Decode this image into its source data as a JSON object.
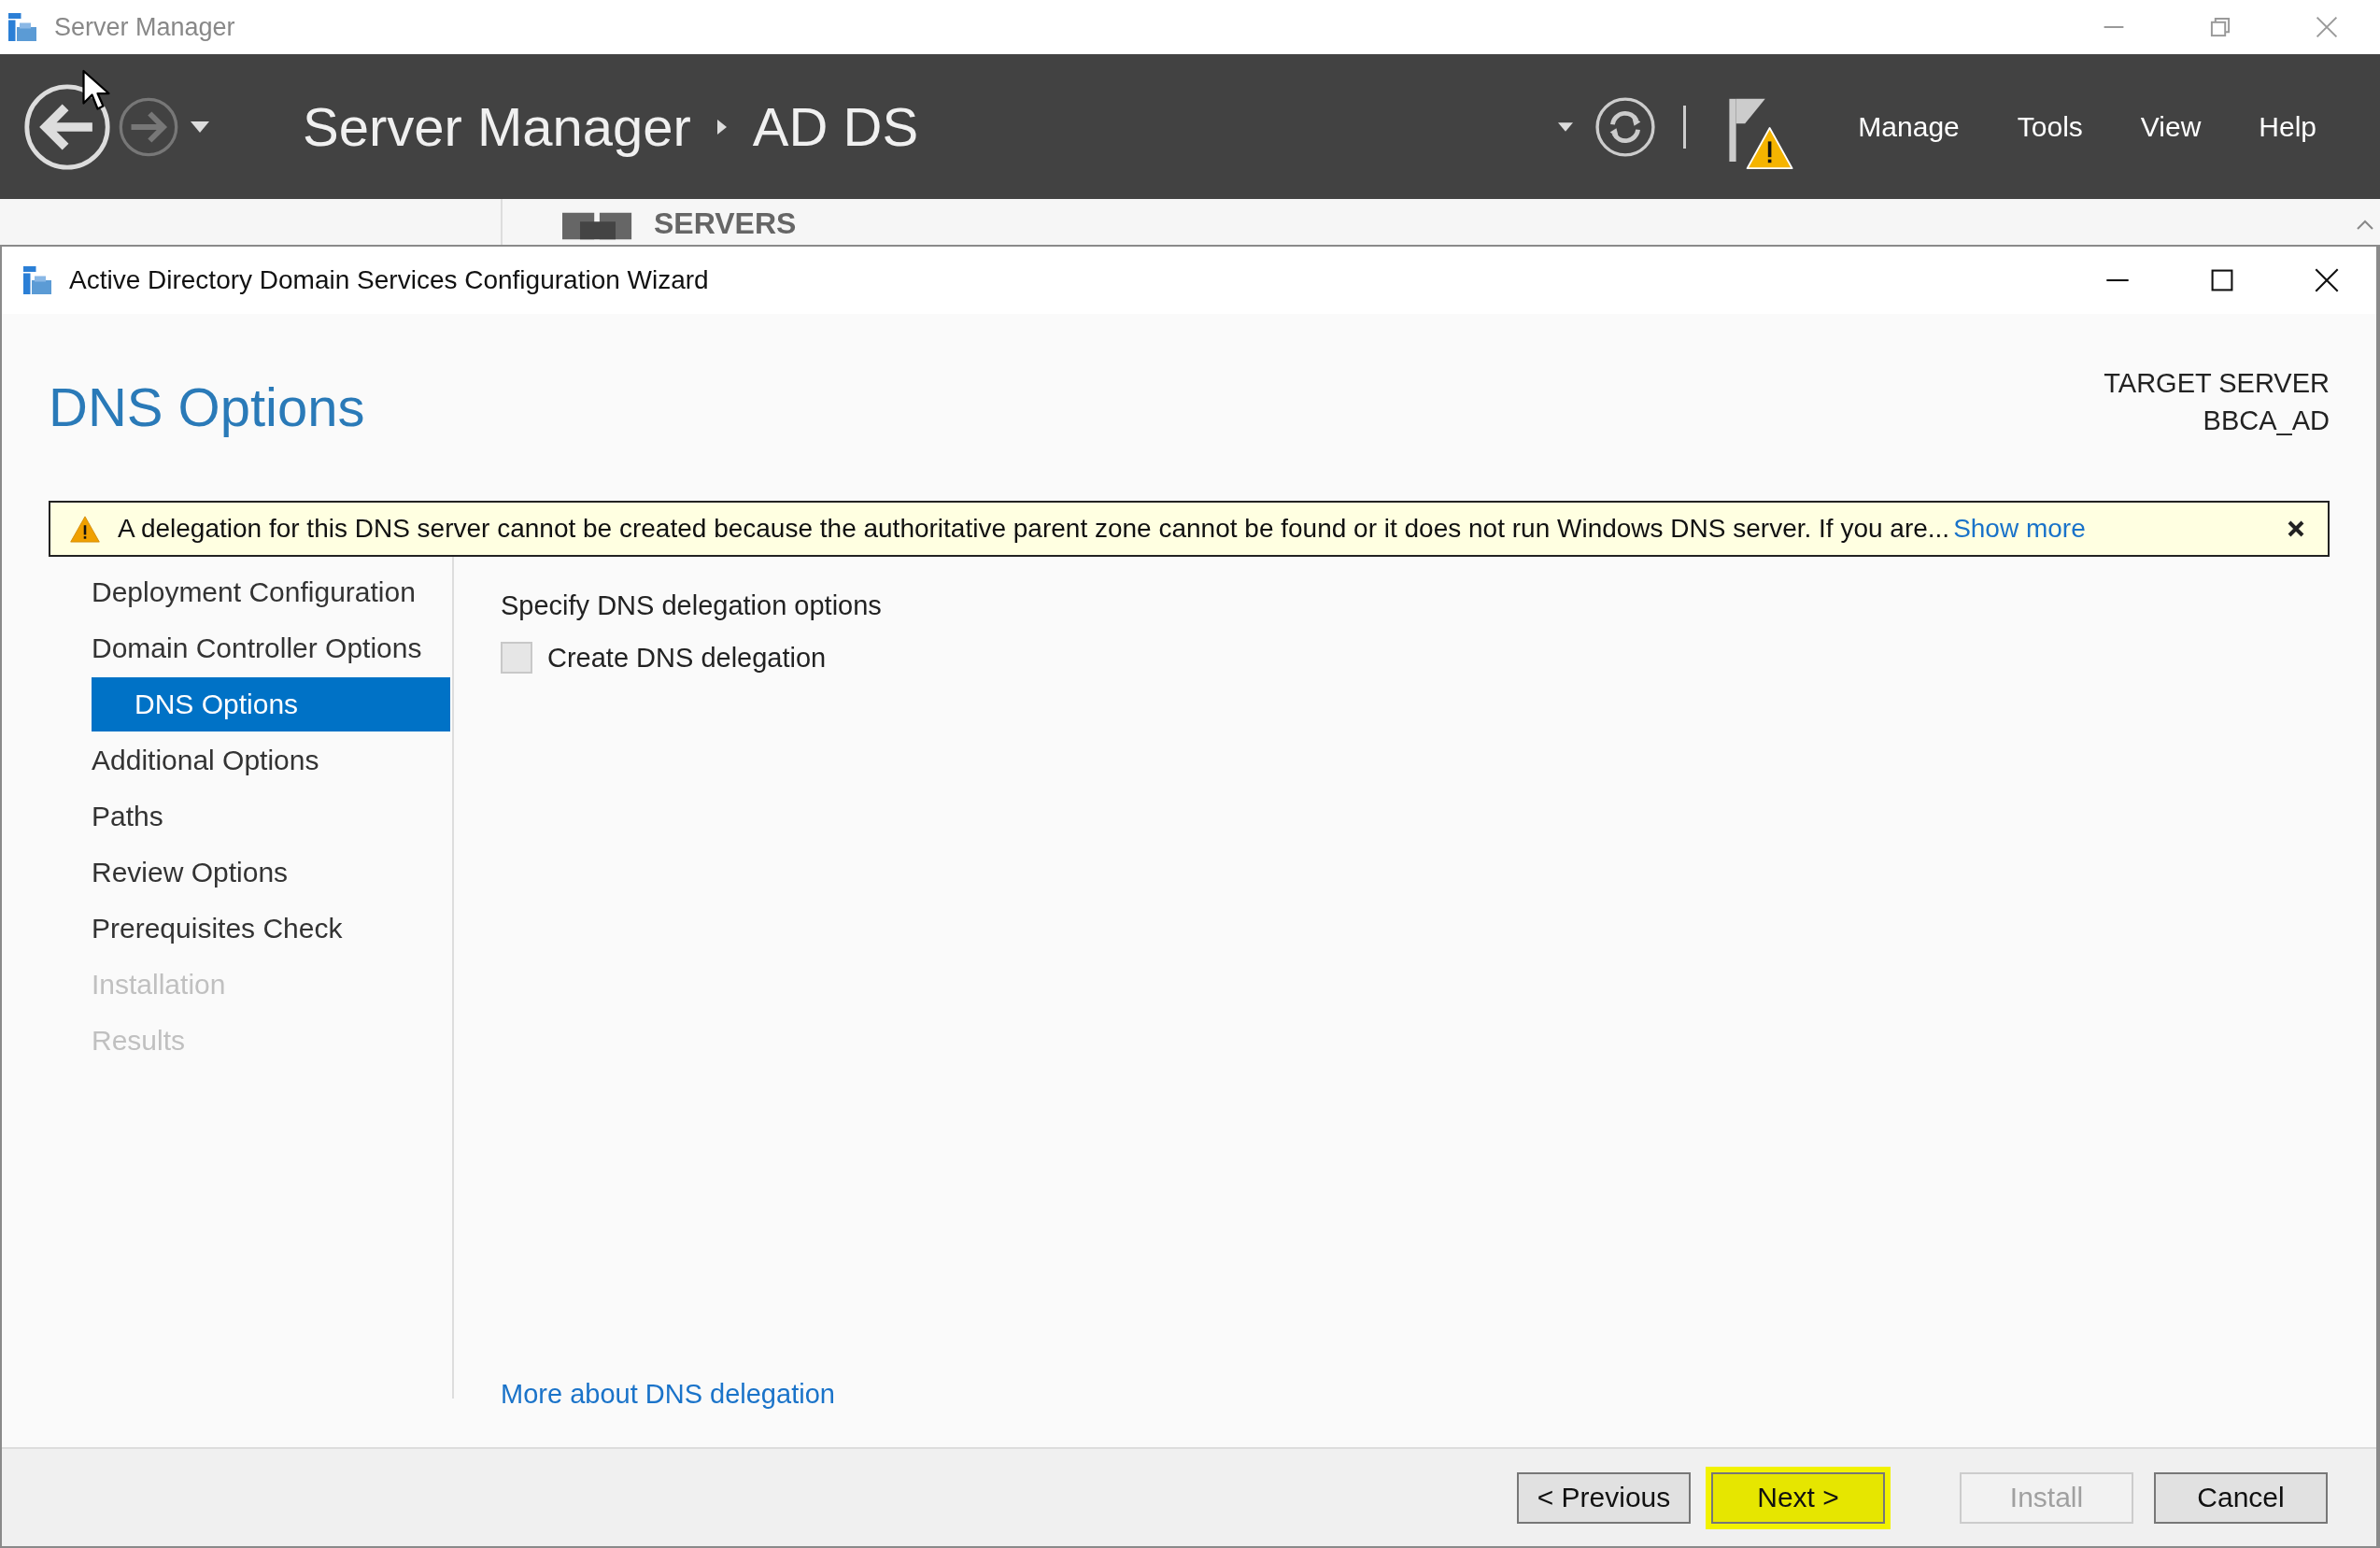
{
  "app": {
    "title": "Server Manager",
    "breadcrumb": [
      "Server Manager",
      "AD DS"
    ],
    "menu": [
      "Manage",
      "Tools",
      "View",
      "Help"
    ],
    "partial_heading": "SERVERS"
  },
  "wizard": {
    "title": "Active Directory Domain Services Configuration Wizard",
    "heading": "DNS Options",
    "target_label": "TARGET SERVER",
    "target_value": "BBCA_AD",
    "warning": {
      "text": "A delegation for this DNS server cannot be created because the authoritative parent zone cannot be found or it does not run Windows DNS server. If you are...",
      "link": "Show more"
    },
    "steps": [
      {
        "label": "Deployment Configuration",
        "selected": false,
        "disabled": false
      },
      {
        "label": "Domain Controller Options",
        "selected": false,
        "disabled": false
      },
      {
        "label": "DNS Options",
        "selected": true,
        "disabled": false
      },
      {
        "label": "Additional Options",
        "selected": false,
        "disabled": false
      },
      {
        "label": "Paths",
        "selected": false,
        "disabled": false
      },
      {
        "label": "Review Options",
        "selected": false,
        "disabled": false
      },
      {
        "label": "Prerequisites Check",
        "selected": false,
        "disabled": false
      },
      {
        "label": "Installation",
        "selected": false,
        "disabled": true
      },
      {
        "label": "Results",
        "selected": false,
        "disabled": true
      }
    ],
    "section_label": "Specify DNS delegation options",
    "options": [
      {
        "label": "Create DNS delegation",
        "checked": false
      }
    ],
    "help_link": "More about DNS delegation",
    "buttons": [
      {
        "label": "< Previous",
        "disabled": false,
        "highlighted": false
      },
      {
        "label": "Next >",
        "disabled": false,
        "highlighted": true
      },
      {
        "label": "Install",
        "disabled": true,
        "highlighted": false
      },
      {
        "label": "Cancel",
        "disabled": false,
        "highlighted": false
      }
    ]
  }
}
